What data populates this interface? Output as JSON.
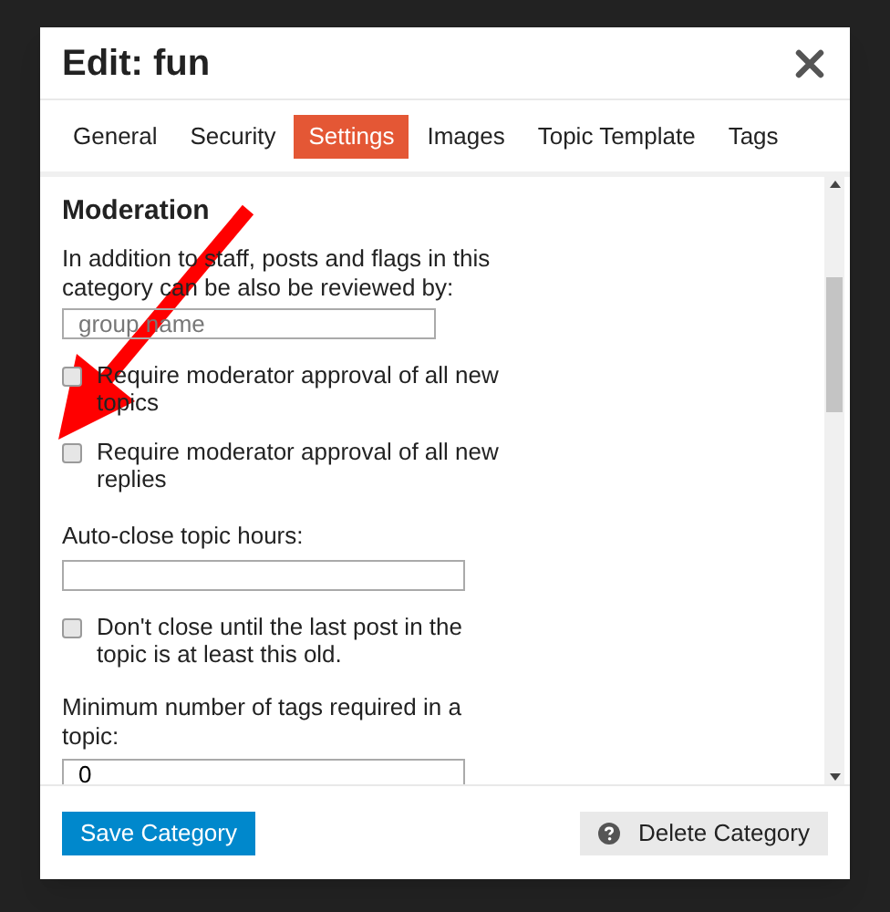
{
  "dialog": {
    "title": "Edit: fun"
  },
  "tabs": [
    {
      "label": "General",
      "selected": false
    },
    {
      "label": "Security",
      "selected": false
    },
    {
      "label": "Settings",
      "selected": true
    },
    {
      "label": "Images",
      "selected": false
    },
    {
      "label": "Topic Template",
      "selected": false
    },
    {
      "label": "Tags",
      "selected": false
    }
  ],
  "section": {
    "heading": "Moderation",
    "description": "In addition to staff, posts and flags in this category can be also be reviewed by:",
    "group_field": {
      "placeholder": "group name"
    },
    "options": [
      {
        "label": "Require moderator approval of all new topics",
        "checked": false
      },
      {
        "label": "Require moderator approval of all new replies",
        "checked": false
      }
    ],
    "auto_close": {
      "label": "Auto-close topic hours:"
    },
    "auto_close_option": {
      "label": "Don't close until the last post in the topic is at least this old.",
      "checked": false
    },
    "min_tags": {
      "label": "Minimum number of tags required in a topic:",
      "value": "0"
    }
  },
  "buttons": {
    "save": "Save Category",
    "delete": "Delete Category"
  }
}
